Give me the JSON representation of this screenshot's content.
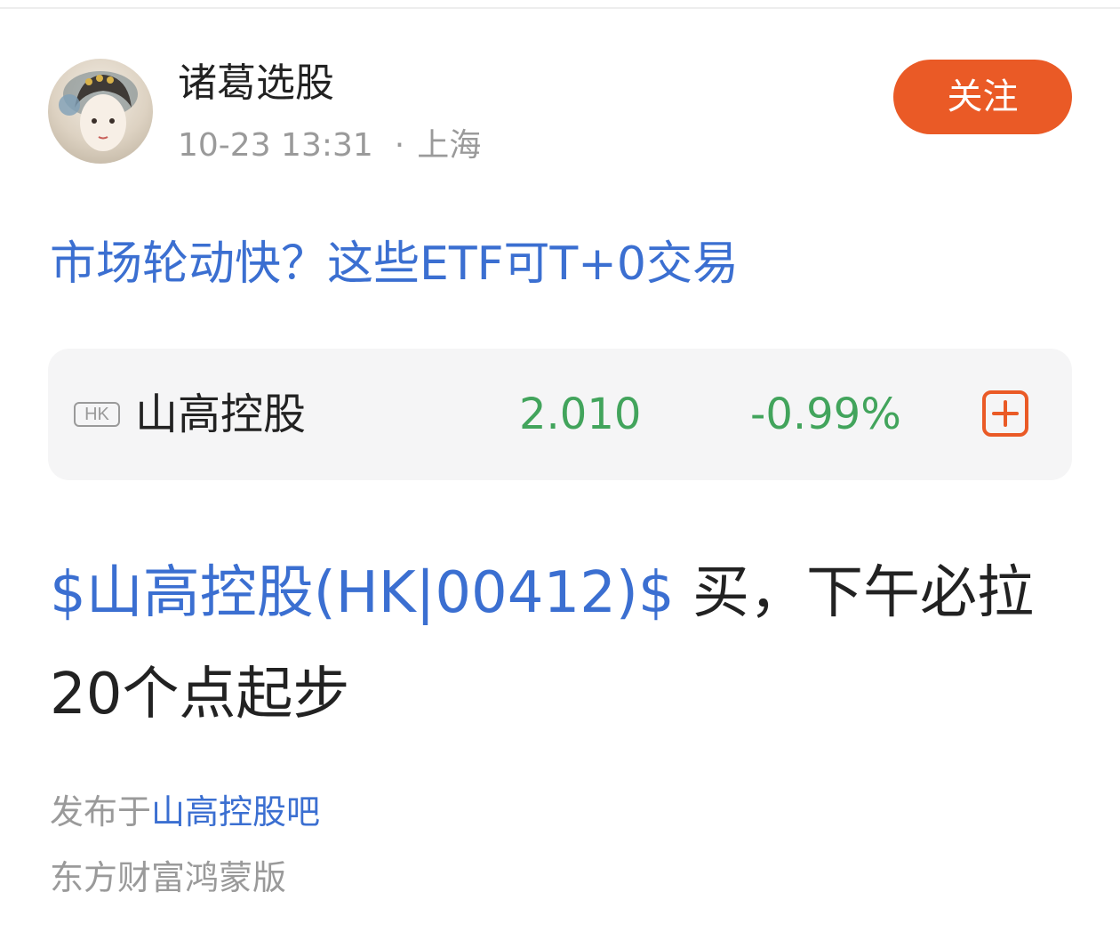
{
  "author": {
    "name": "诸葛选股",
    "time": "10-23 13:31",
    "separator": "·",
    "location": "上海"
  },
  "follow_label": "关注",
  "post": {
    "title": "市场轮动快？这些ETF可T+0交易",
    "stock_card": {
      "market": "HK",
      "name": "山高控股",
      "price": "2.010",
      "change": "-0.99%"
    },
    "stock_link": "$山高控股(HK|00412)$",
    "body": "买，下午必拉20个点起步"
  },
  "footer": {
    "posted_in_prefix": "发布于",
    "forum": "山高控股吧",
    "client": "东方财富鸿蒙版"
  },
  "colors": {
    "accent_blue": "#3b6fd1",
    "follow_orange": "#ea5a26",
    "price_green": "#42a45c"
  }
}
